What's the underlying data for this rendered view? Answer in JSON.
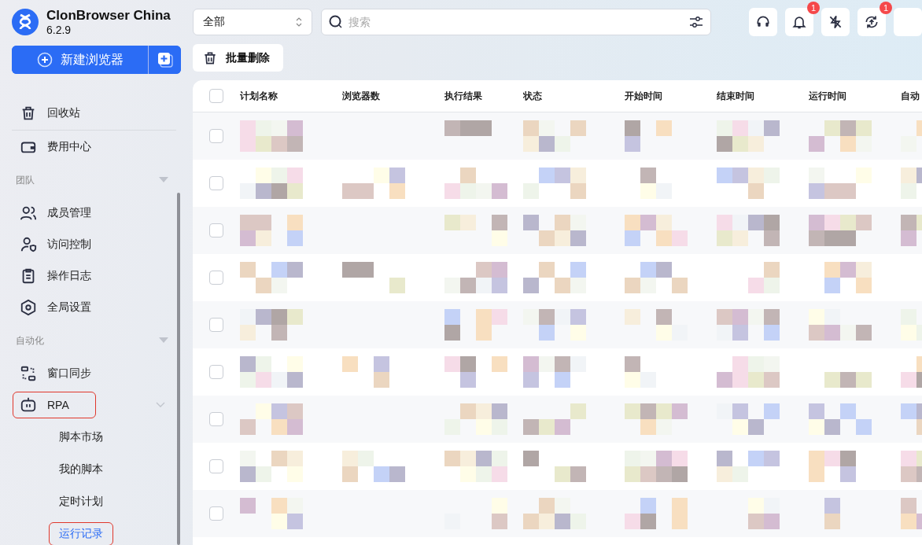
{
  "app": {
    "name": "ClonBrowser China",
    "version": "6.2.9"
  },
  "new_browser_button": {
    "label": "新建浏览器"
  },
  "sidebar": {
    "items": [
      {
        "kind": "item",
        "label": "回收站",
        "selected": false,
        "highlighted": false
      },
      {
        "kind": "divider"
      },
      {
        "kind": "item",
        "label": "费用中心",
        "selected": false,
        "highlighted": false
      },
      {
        "kind": "section",
        "label": "团队"
      },
      {
        "kind": "item",
        "label": "成员管理",
        "selected": false,
        "highlighted": false
      },
      {
        "kind": "item",
        "label": "访问控制",
        "selected": false,
        "highlighted": false
      },
      {
        "kind": "item",
        "label": "操作日志",
        "selected": false,
        "highlighted": false
      },
      {
        "kind": "item",
        "label": "全局设置",
        "selected": false,
        "highlighted": false
      },
      {
        "kind": "section",
        "label": "自动化"
      },
      {
        "kind": "item",
        "label": "窗口同步",
        "selected": false,
        "highlighted": false
      },
      {
        "kind": "group",
        "label": "RPA",
        "expanded": true,
        "highlighted": true,
        "children": [
          {
            "label": "脚本市场",
            "selected": false,
            "highlighted": false
          },
          {
            "label": "我的脚本",
            "selected": false,
            "highlighted": false
          },
          {
            "label": "定时计划",
            "selected": false,
            "highlighted": false
          },
          {
            "label": "运行记录",
            "selected": true,
            "highlighted": true
          }
        ]
      }
    ]
  },
  "filter": {
    "value": "全部"
  },
  "search": {
    "placeholder": "搜索"
  },
  "toolbar_icons": [
    {
      "kind": "plain"
    },
    {
      "kind": "badged",
      "badge": "1"
    },
    {
      "kind": "plain"
    },
    {
      "kind": "badged",
      "badge": "1"
    }
  ],
  "batch_delete_button": {
    "label": "批量删除"
  },
  "table": {
    "select_all_checked": false,
    "columns": [
      "计划名称",
      "浏览器数",
      "执行结果",
      "状态",
      "开始时间",
      "结束时间",
      "运行时间",
      "自动"
    ],
    "rows": [
      {
        "checked": false
      },
      {
        "checked": false
      },
      {
        "checked": false
      },
      {
        "checked": false
      },
      {
        "checked": false
      },
      {
        "checked": false
      },
      {
        "checked": false
      },
      {
        "checked": false
      },
      {
        "checked": false
      }
    ]
  }
}
